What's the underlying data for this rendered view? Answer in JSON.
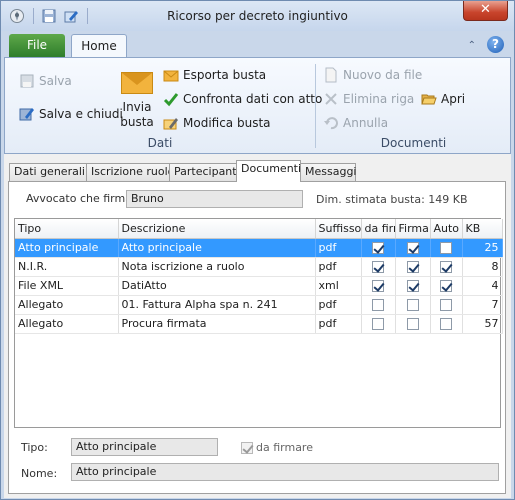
{
  "window": {
    "title": "Ricorso per decreto ingiuntivo",
    "close_glyph": "✕"
  },
  "ribbon_tabs": {
    "file": "File",
    "home": "Home",
    "help_glyph": "?",
    "collapse_glyph": "⌃"
  },
  "ribbon": {
    "dati": {
      "salva": "Salva",
      "salva_chiudi": "Salva e chiudi",
      "invia_busta": "Invia busta",
      "esporta_busta": "Esporta busta",
      "confronta": "Confronta dati con atto",
      "modifica_busta": "Modifica busta",
      "group_label": "Dati"
    },
    "documenti": {
      "nuovo": "Nuovo da file",
      "elimina": "Elimina riga",
      "annulla": "Annulla",
      "apri": "Apri",
      "group_label": "Documenti"
    }
  },
  "tabs": [
    "Dati generali",
    "Iscrizione ruolo",
    "Partecipanti",
    "Documenti",
    "Messaggi"
  ],
  "active_tab": "Documenti",
  "form": {
    "avvocato_label": "Avvocato che firma:",
    "avvocato_value": "Bruno",
    "dim_label": "Dim. stimata busta: 149 KB",
    "tipo_label": "Tipo:",
    "tipo_value": "Atto principale",
    "da_firmare_label": "da firmare",
    "da_firmare_checked": true,
    "nome_label": "Nome:",
    "nome_value": "Atto principale"
  },
  "grid": {
    "columns": [
      "Tipo",
      "Descrizione",
      "Suffisso",
      "da firm",
      "Firma",
      "Auto",
      "KB"
    ],
    "rows": [
      {
        "tipo": "Atto principale",
        "descrizione": "Atto principale",
        "suffisso": "pdf",
        "da_firmare": true,
        "firma": true,
        "auto": false,
        "kb": "25",
        "selected": true
      },
      {
        "tipo": "N.I.R.",
        "descrizione": "Nota iscrizione a ruolo",
        "suffisso": "pdf",
        "da_firmare": true,
        "firma": true,
        "auto": true,
        "kb": "8",
        "selected": false
      },
      {
        "tipo": "File XML",
        "descrizione": "DatiAtto",
        "suffisso": "xml",
        "da_firmare": true,
        "firma": true,
        "auto": true,
        "kb": "4",
        "selected": false
      },
      {
        "tipo": "Allegato",
        "descrizione": "01. Fattura Alpha spa n. 241",
        "suffisso": "pdf",
        "da_firmare": false,
        "firma": false,
        "auto": false,
        "kb": "7",
        "selected": false
      },
      {
        "tipo": "Allegato",
        "descrizione": "Procura firmata",
        "suffisso": "pdf",
        "da_firmare": false,
        "firma": false,
        "auto": false,
        "kb": "57",
        "selected": false
      }
    ]
  }
}
